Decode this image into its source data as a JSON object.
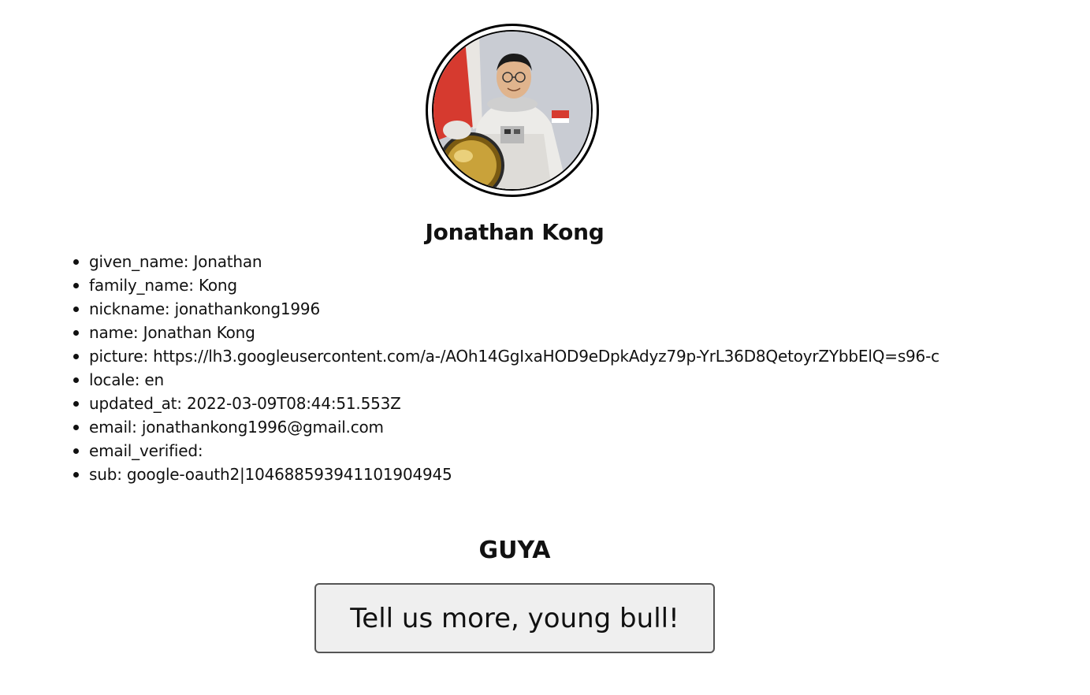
{
  "profile": {
    "avatar_alt": "profile picture",
    "name": "Jonathan Kong"
  },
  "info": [
    {
      "label": "given_name: Jonathan"
    },
    {
      "label": "family_name: Kong"
    },
    {
      "label": "nickname: jonathankong1996"
    },
    {
      "label": "name: Jonathan Kong"
    },
    {
      "label": "picture: https://lh3.googleusercontent.com/a-/AOh14GgIxaHOD9eDpkAdyz79p-YrL36D8QetoyrZYbbElQ=s96-c"
    },
    {
      "label": "locale: en"
    },
    {
      "label": "updated_at: 2022-03-09T08:44:51.553Z"
    },
    {
      "label": "email: jonathankong1996@gmail.com"
    },
    {
      "label": "email_verified:"
    },
    {
      "label": "sub: google-oauth2|104688593941101904945"
    }
  ],
  "section": {
    "title": "GUYA"
  },
  "cta": {
    "label": "Tell us more, young bull!"
  },
  "colors": {
    "button_bg": "#efefef",
    "button_border": "#555555",
    "text": "#111111"
  }
}
